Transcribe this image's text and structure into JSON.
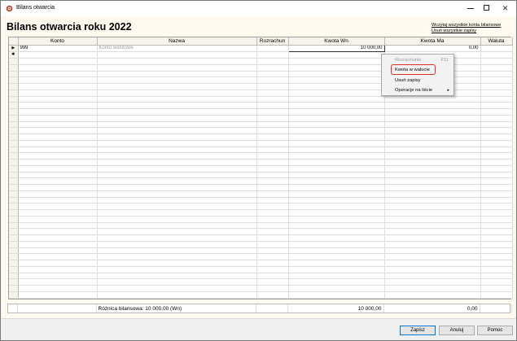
{
  "window": {
    "title": "Bilans otwarcia",
    "minimize_glyph": "",
    "close_glyph": "✕"
  },
  "header": {
    "page_title": "Bilans otwarcia roku 2022",
    "link_import": "Wczytaj wszystkie konta bilansowe",
    "link_delete": "Usuń wszystkie zapisy"
  },
  "grid": {
    "columns": [
      "Konto",
      "Nazwa",
      "Rozrachun",
      "Kwota Wn",
      "Kwota Ma",
      "Waluta"
    ],
    "rows": [
      {
        "indicator": "▶",
        "konto": "999",
        "nazwa": "Konto walutowe",
        "rozrachun": "",
        "kwota_wn": "10 000,00",
        "kwota_ma": "0,00",
        "waluta": ""
      },
      {
        "indicator": "✱",
        "konto": "",
        "nazwa": "",
        "rozrachun": "",
        "kwota_wn": "",
        "kwota_ma": "",
        "waluta": ""
      }
    ]
  },
  "footer": {
    "difference_label": "Różnica bilansowa: 10 000,00 (Wn)",
    "sum_wn": "10 000,00",
    "sum_ma": "0,00"
  },
  "context_menu": {
    "items": [
      {
        "label": "Rozrachunki",
        "shortcut": "F11",
        "disabled": true
      },
      {
        "label": "Kwota w walucie",
        "highlighted": true
      },
      {
        "label": "Usuń zapisy"
      },
      {
        "label": "Operacje na liście",
        "submenu": true,
        "arrow": "▸"
      }
    ],
    "highlight_color": "#e0302a"
  },
  "buttons": {
    "save": "Zapisz",
    "cancel": "Anuluj",
    "help": "Pomoc"
  },
  "colors": {
    "content_bg": "#fefaf0",
    "accent": "#0078d7"
  }
}
